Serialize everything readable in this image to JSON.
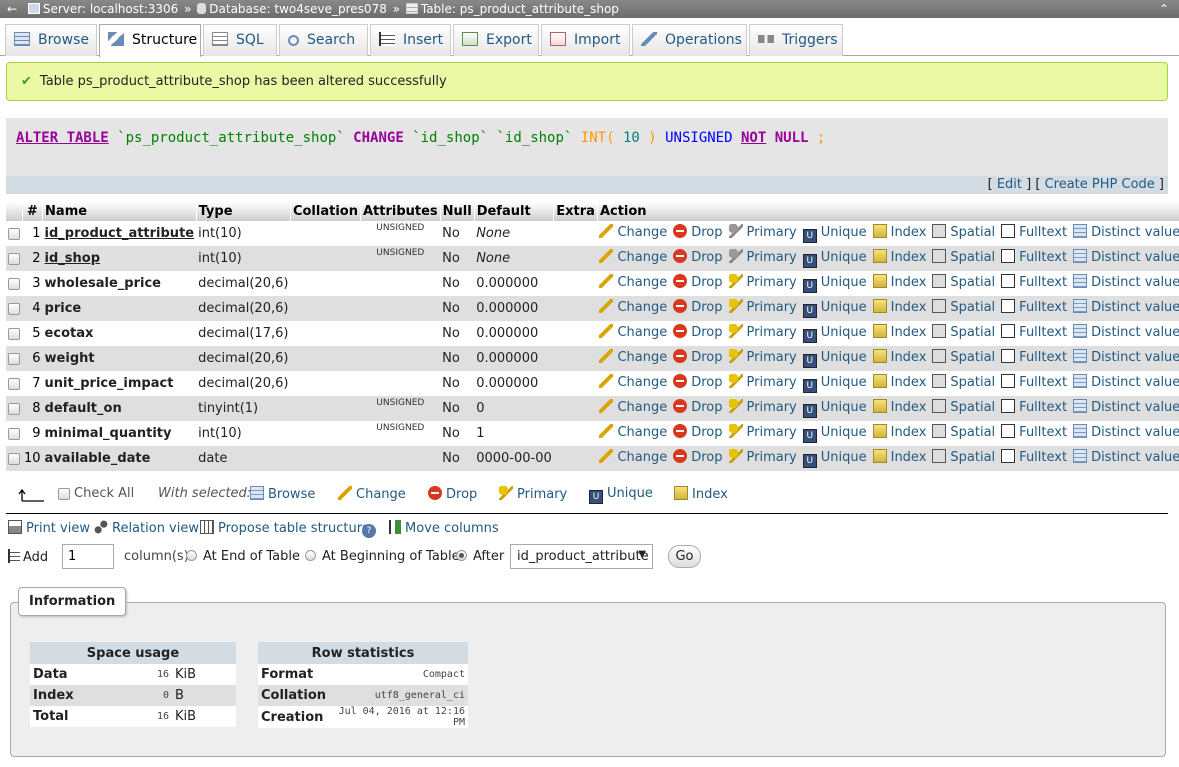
{
  "breadcrumb": {
    "server": "Server: localhost:3306",
    "database": "Database: two4seve_pres078",
    "table": "Table: ps_product_attribute_shop",
    "separator": "»"
  },
  "tabs": [
    {
      "label": "Browse",
      "icon": "browse-icon"
    },
    {
      "label": "Structure",
      "icon": "structure-icon"
    },
    {
      "label": "SQL",
      "icon": "sql-icon"
    },
    {
      "label": "Search",
      "icon": "search-icon"
    },
    {
      "label": "Insert",
      "icon": "insert-icon"
    },
    {
      "label": "Export",
      "icon": "export-icon"
    },
    {
      "label": "Import",
      "icon": "import-icon"
    },
    {
      "label": "Operations",
      "icon": "wrench-icon"
    },
    {
      "label": "Triggers",
      "icon": "triggers-icon"
    }
  ],
  "success_message": "Table ps_product_attribute_shop has been altered successfully",
  "sql": {
    "alter_table": "ALTER TABLE",
    "table_name": "`ps_product_attribute_shop`",
    "change": "CHANGE",
    "col_old": "`id_shop`",
    "col_new": "`id_shop`",
    "int_fn": "INT(",
    "int_len": "10",
    "int_close": ")",
    "unsigned": "UNSIGNED",
    "not": "NOT",
    "null": "NULL",
    "semicolon": ";"
  },
  "sql_links": {
    "open": "[",
    "edit": "Edit",
    "mid": "] [",
    "php": "Create PHP Code",
    "close": "]"
  },
  "columns_header": [
    "#",
    "Name",
    "Type",
    "Collation",
    "Attributes",
    "Null",
    "Default",
    "Extra",
    "Action"
  ],
  "rows": [
    {
      "num": "1",
      "name": "id_product_attribute",
      "type": "int(10)",
      "collation": "",
      "attributes": "UNSIGNED",
      "null": "No",
      "default": "None",
      "extra": ""
    },
    {
      "num": "2",
      "name": "id_shop",
      "type": "int(10)",
      "collation": "",
      "attributes": "UNSIGNED",
      "null": "No",
      "default": "None",
      "extra": ""
    },
    {
      "num": "3",
      "name": "wholesale_price",
      "type": "decimal(20,6)",
      "collation": "",
      "attributes": "",
      "null": "No",
      "default": "0.000000",
      "extra": ""
    },
    {
      "num": "4",
      "name": "price",
      "type": "decimal(20,6)",
      "collation": "",
      "attributes": "",
      "null": "No",
      "default": "0.000000",
      "extra": ""
    },
    {
      "num": "5",
      "name": "ecotax",
      "type": "decimal(17,6)",
      "collation": "",
      "attributes": "",
      "null": "No",
      "default": "0.000000",
      "extra": ""
    },
    {
      "num": "6",
      "name": "weight",
      "type": "decimal(20,6)",
      "collation": "",
      "attributes": "",
      "null": "No",
      "default": "0.000000",
      "extra": ""
    },
    {
      "num": "7",
      "name": "unit_price_impact",
      "type": "decimal(20,6)",
      "collation": "",
      "attributes": "",
      "null": "No",
      "default": "0.000000",
      "extra": ""
    },
    {
      "num": "8",
      "name": "default_on",
      "type": "tinyint(1)",
      "collation": "",
      "attributes": "UNSIGNED",
      "null": "No",
      "default": "0",
      "extra": ""
    },
    {
      "num": "9",
      "name": "minimal_quantity",
      "type": "int(10)",
      "collation": "",
      "attributes": "UNSIGNED",
      "null": "No",
      "default": "1",
      "extra": ""
    },
    {
      "num": "10",
      "name": "available_date",
      "type": "date",
      "collation": "",
      "attributes": "",
      "null": "No",
      "default": "0000-00-00",
      "extra": ""
    }
  ],
  "row_actions": {
    "change": "Change",
    "drop": "Drop",
    "primary": "Primary",
    "unique": "Unique",
    "index": "Index",
    "spatial": "Spatial",
    "fulltext": "Fulltext",
    "distinct": "Distinct values"
  },
  "with_selected": {
    "check_all": "Check All",
    "label": "With selected:",
    "browse": "Browse",
    "change": "Change",
    "drop": "Drop",
    "primary": "Primary",
    "unique": "Unique",
    "index": "Index"
  },
  "links": {
    "print_view": "Print view",
    "relation_view": "Relation view",
    "propose": "Propose table structure",
    "move_columns": "Move columns"
  },
  "add_columns": {
    "add_label": "Add",
    "count": "1",
    "columns_label": "column(s)",
    "at_end": "At End of Table",
    "at_beginning": "At Beginning of Table",
    "after": "After",
    "after_column": "id_product_attribute",
    "go": "Go"
  },
  "information": {
    "legend": "Information",
    "space_usage": {
      "title": "Space usage",
      "rows": [
        {
          "label": "Data",
          "value": "16",
          "unit": "KiB"
        },
        {
          "label": "Index",
          "value": "0",
          "unit": "B"
        },
        {
          "label": "Total",
          "value": "16",
          "unit": "KiB"
        }
      ]
    },
    "row_statistics": {
      "title": "Row statistics",
      "rows": [
        {
          "label": "Format",
          "value": "Compact"
        },
        {
          "label": "Collation",
          "value": "utf8_general_ci"
        },
        {
          "label": "Creation",
          "value": "Jul 04, 2016 at 12:16 PM"
        }
      ]
    }
  }
}
